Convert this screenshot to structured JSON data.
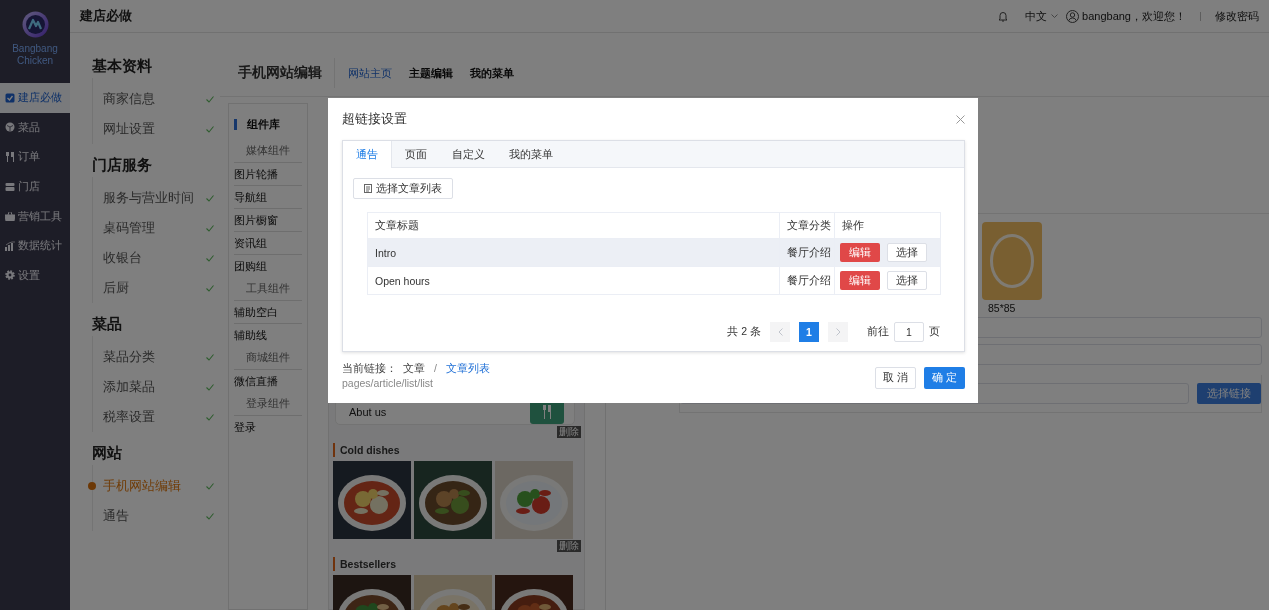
{
  "sidebar": {
    "brand": "Bangbang Chicken",
    "items": [
      {
        "label": "建店必做",
        "selected": true
      },
      {
        "label": "菜品",
        "selected": false
      },
      {
        "label": "订单",
        "selected": false
      },
      {
        "label": "门店",
        "selected": false
      },
      {
        "label": "营销工具",
        "selected": false
      },
      {
        "label": "数据统计",
        "selected": false
      },
      {
        "label": "设置",
        "selected": false
      }
    ]
  },
  "header": {
    "title": "建店必做",
    "language": "中文",
    "greeting": "bangbang，欢迎您！",
    "change_password": "修改密码"
  },
  "checklist": [
    {
      "heading": "基本资料",
      "items": [
        {
          "label": "商家信息",
          "done": true,
          "current": false
        },
        {
          "label": "网址设置",
          "done": true,
          "current": false
        }
      ]
    },
    {
      "heading": "门店服务",
      "items": [
        {
          "label": "服务与营业时间",
          "done": true,
          "current": false
        },
        {
          "label": "桌码管理",
          "done": true,
          "current": false
        },
        {
          "label": "收银台",
          "done": true,
          "current": false
        },
        {
          "label": "后厨",
          "done": true,
          "current": false
        }
      ]
    },
    {
      "heading": "菜品",
      "items": [
        {
          "label": "菜品分类",
          "done": true,
          "current": false
        },
        {
          "label": "添加菜品",
          "done": true,
          "current": false
        },
        {
          "label": "税率设置",
          "done": true,
          "current": false
        }
      ]
    },
    {
      "heading": "网站",
      "items": [
        {
          "label": "手机网站编辑",
          "done": true,
          "current": true
        },
        {
          "label": "通告",
          "done": true,
          "current": false
        }
      ]
    }
  ],
  "editor": {
    "title": "手机网站编辑",
    "tabs": [
      {
        "label": "网站主页",
        "selected": true
      },
      {
        "label": "主题编辑",
        "selected": false
      },
      {
        "label": "我的菜单",
        "selected": false
      }
    ]
  },
  "components": {
    "title": "组件库",
    "groups": [
      {
        "heading": "媒体组件",
        "items": [
          "图片轮播",
          "导航组",
          "图片橱窗",
          "资讯组",
          "团购组"
        ]
      },
      {
        "heading": "工具组件",
        "items": [
          "辅助空白",
          "辅助线"
        ]
      },
      {
        "heading": "商城组件",
        "items": [
          "微信直播"
        ]
      },
      {
        "heading": "登录组件",
        "items": [
          "登录"
        ]
      }
    ]
  },
  "preview": {
    "about_card": {
      "label": "Abut us",
      "delete": "删除"
    },
    "sections": [
      {
        "title": "Cold dishes",
        "delete": "删除"
      },
      {
        "title": "Bestsellers"
      }
    ]
  },
  "settings": {
    "icon_size": "85*85",
    "link_button": "选择链接"
  },
  "dialog": {
    "title": "超链接设置",
    "tabs": [
      {
        "label": "通告",
        "selected": true
      },
      {
        "label": "页面",
        "selected": false
      },
      {
        "label": "自定义",
        "selected": false
      },
      {
        "label": "我的菜单",
        "selected": false
      }
    ],
    "choose_button": "选择文章列表",
    "table": {
      "columns": [
        "文章标题",
        "文章分类",
        "操作"
      ],
      "rows": [
        {
          "title": "Intro",
          "category": "餐厅介绍",
          "highlighted": true,
          "actions": [
            "编辑",
            "选择"
          ]
        },
        {
          "title": "Open hours",
          "category": "餐厅介绍",
          "highlighted": false,
          "actions": [
            "编辑",
            "选择"
          ]
        }
      ]
    },
    "pagination": {
      "total": "共 2 条",
      "pages": [
        {
          "label": "1",
          "selected": true
        }
      ],
      "goto_label": "前往",
      "goto_value": "1",
      "page_suffix": "页"
    },
    "current_link": {
      "label": "当前链接：",
      "path": [
        "文章",
        "文章列表"
      ],
      "separator": "/",
      "url": "pages/article/list/list"
    },
    "buttons": {
      "cancel": "取 消",
      "confirm": "确 定"
    }
  }
}
